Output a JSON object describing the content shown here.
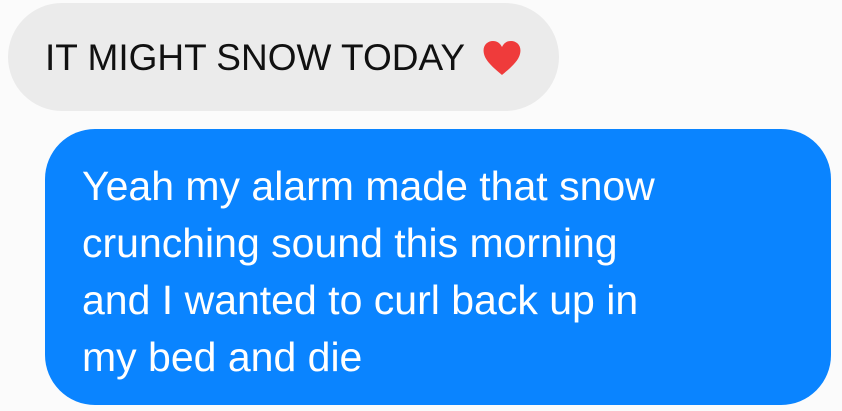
{
  "conversation": {
    "received_message": {
      "text": "IT MIGHT SNOW TODAY",
      "emoji": "heart-icon"
    },
    "sent_message": {
      "lines": [
        "Yeah my alarm made that snow",
        "crunching sound this morning",
        "and I wanted to curl back up in",
        "my bed and die"
      ]
    }
  },
  "colors": {
    "received_bubble": "#ebebeb",
    "sent_bubble": "#0a84ff",
    "heart": "#ef3b3b"
  }
}
